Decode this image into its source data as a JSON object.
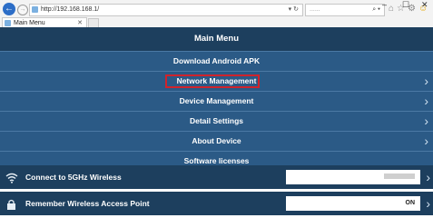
{
  "browser": {
    "address_url": "http://192.168.168.1/",
    "reload_glyph": "▾ ↻",
    "search_placeholder": "......",
    "tab_title": "Main Menu",
    "tab_close": "✕",
    "window_minimize": "–",
    "window_maximize": "☐",
    "window_close": "✕",
    "back_glyph": "←",
    "forward_glyph": "→",
    "search_glyph": "⌕ ▾",
    "icons": [
      "home-icon",
      "star-icon",
      "gear-icon",
      "smiley-icon"
    ]
  },
  "menu": {
    "title": "Main Menu",
    "items": [
      {
        "label": "Download Android APK",
        "has_chevron": false
      },
      {
        "label": "Network Management",
        "has_chevron": true,
        "highlighted": true
      },
      {
        "label": "Device Management",
        "has_chevron": true
      },
      {
        "label": "Detail Settings",
        "has_chevron": true
      },
      {
        "label": "About Device",
        "has_chevron": true
      },
      {
        "label": "Software licenses",
        "has_chevron": false
      }
    ]
  },
  "settings": {
    "wireless_5ghz": {
      "label": "Connect to 5GHz Wireless",
      "icon": "wifi-icon"
    },
    "remember_ap": {
      "label": "Remember Wireless Access Point",
      "value": "ON",
      "icon": "lock-icon"
    }
  },
  "chevron_glyph": "›",
  "colors": {
    "header_bg": "#1d3f5e",
    "item_bg": "#2b5a86",
    "highlight_border": "#d0232b"
  }
}
